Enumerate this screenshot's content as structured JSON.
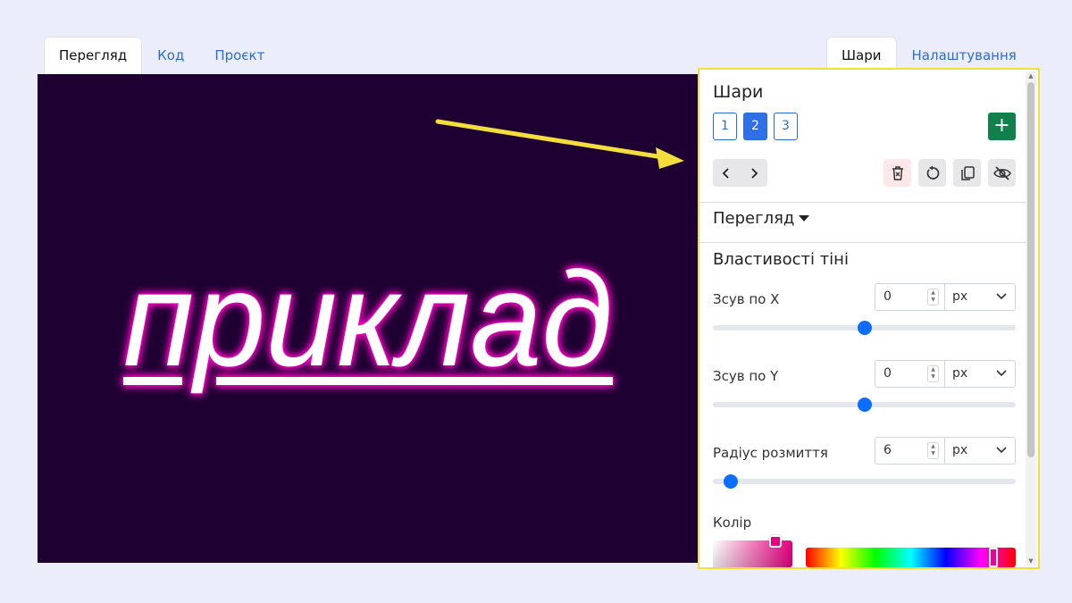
{
  "tabs_left": [
    {
      "label": "Перегляд",
      "active": true
    },
    {
      "label": "Код",
      "active": false
    },
    {
      "label": "Проєкт",
      "active": false
    }
  ],
  "tabs_right": [
    {
      "label": "Шари",
      "active": true
    },
    {
      "label": "Налаштування",
      "active": false
    }
  ],
  "preview": {
    "text": "приклад",
    "background": "#1f0033",
    "glow_color": "#ff00c8",
    "text_color": "#ffffff"
  },
  "panel": {
    "title": "Шари",
    "layers": [
      "1",
      "2",
      "3"
    ],
    "active_layer": "2",
    "add_icon": "plus-icon",
    "tools": [
      "delete-icon",
      "reset-icon",
      "copy-icon",
      "eye-slash-icon"
    ],
    "preview_section": "Перегляд",
    "shadow_title": "Властивості тіні",
    "fields": {
      "offset_x": {
        "label": "Зсув по X",
        "value": "0",
        "unit": "px",
        "slider_fraction": 0.5
      },
      "offset_y": {
        "label": "Зсув по Y",
        "value": "0",
        "unit": "px",
        "slider_fraction": 0.5
      },
      "blur": {
        "label": "Радіус розмиття",
        "value": "6",
        "unit": "px",
        "slider_fraction": 0.06
      }
    },
    "color_label": "Колір",
    "color": "#e6007e",
    "accent": "#2f6fe8",
    "highlight_border": "#f2df3c"
  }
}
